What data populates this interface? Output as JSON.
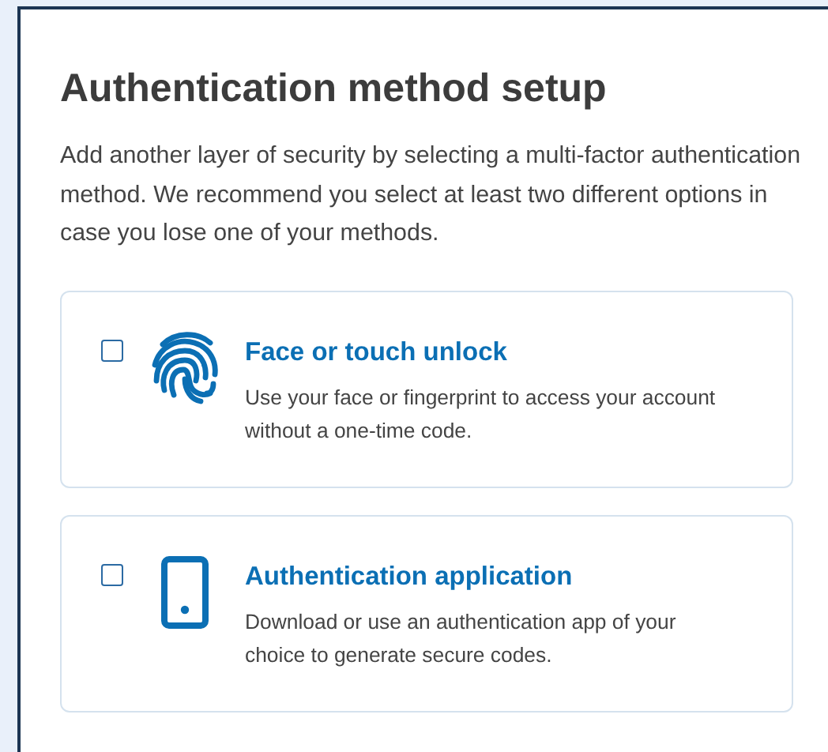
{
  "title": "Authentication method setup",
  "intro": "Add another layer of security by selecting a multi-factor authentication method. We recommend you select at least two different options in case you lose one of your methods.",
  "options": [
    {
      "kind": "biometric",
      "title": "Face or touch unlock",
      "description": "Use your face or fingerprint to access your account without a one-time code.",
      "checked": false
    },
    {
      "kind": "app",
      "title": "Authentication application",
      "description": "Download or use an authentication app of your choice to generate secure codes.",
      "checked": false
    }
  ]
}
